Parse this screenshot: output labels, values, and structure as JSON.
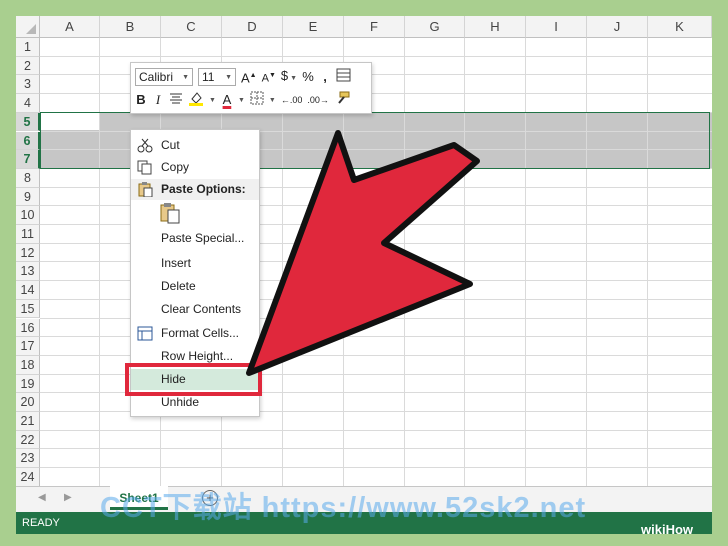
{
  "columns": [
    "A",
    "B",
    "C",
    "D",
    "E",
    "F",
    "G",
    "H",
    "I",
    "J",
    "K"
  ],
  "rows": [
    "1",
    "2",
    "3",
    "4",
    "5",
    "6",
    "7",
    "8",
    "9",
    "10",
    "11",
    "12",
    "13",
    "14",
    "15",
    "16",
    "17",
    "18",
    "19",
    "20",
    "21",
    "22",
    "23",
    "24"
  ],
  "selected_rows": [
    "5",
    "6",
    "7"
  ],
  "mini_toolbar": {
    "font_name": "Calibri",
    "font_size": "11",
    "grow_font": "A",
    "shrink_font": "A",
    "currency": "$",
    "percent": "%",
    "comma": ",",
    "bold": "B",
    "font_color": "A",
    "decrease_decimal": ".00",
    "increase_decimal": ".00"
  },
  "context_menu": {
    "items": [
      {
        "label": "Cut",
        "icon": "scissors-icon"
      },
      {
        "label": "Copy",
        "icon": "copy-icon"
      },
      {
        "label": "Paste Options:",
        "icon": "clipboard-icon"
      },
      {
        "label": "Paste Special..."
      },
      {
        "label": "Insert"
      },
      {
        "label": "Delete"
      },
      {
        "label": "Clear Contents"
      },
      {
        "label": "Format Cells...",
        "icon": "format-cells-icon"
      },
      {
        "label": "Row Height..."
      },
      {
        "label": "Hide"
      },
      {
        "label": "Unhide"
      }
    ]
  },
  "sheet_tab": "Sheet1",
  "status": "READY",
  "watermark": "CCT下载站 https://www.52sk2.net",
  "brand": "wikiHow",
  "colors": {
    "excel_green": "#217346",
    "arrow_red": "#e0283c",
    "selection_gray": "#c6c6c6",
    "frame_green": "#a9cf8f"
  }
}
